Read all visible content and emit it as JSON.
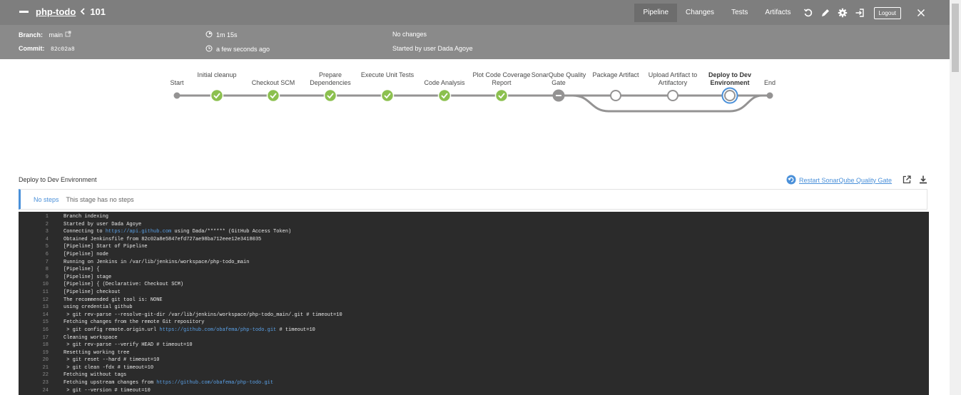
{
  "header": {
    "project": "php-todo",
    "build": "101",
    "tabs": [
      {
        "label": "Pipeline",
        "active": true
      },
      {
        "label": "Changes",
        "active": false
      },
      {
        "label": "Tests",
        "active": false
      },
      {
        "label": "Artifacts",
        "active": false
      }
    ],
    "logout": "Logout",
    "icons": [
      "replay-icon",
      "edit-icon",
      "gear-icon",
      "exit-icon",
      "close-icon"
    ],
    "branch_label": "Branch:",
    "branch_value": "main",
    "commit_label": "Commit:",
    "commit_value": "82c02a8",
    "duration": "1m 15s",
    "time_ago": "a few seconds ago",
    "changes": "No changes",
    "started_by": "Started by user Dada Agoye"
  },
  "pipeline": {
    "stages": [
      {
        "label": "Start",
        "status": "start"
      },
      {
        "label": "Initial cleanup",
        "status": "success"
      },
      {
        "label": "Checkout SCM",
        "status": "success"
      },
      {
        "label": "Prepare Dependencies",
        "status": "success"
      },
      {
        "label": "Execute Unit Tests",
        "status": "success"
      },
      {
        "label": "Code Analysis",
        "status": "success"
      },
      {
        "label": "Plot Code Coverage Report",
        "status": "success"
      },
      {
        "label": "SonarQube Quality Gate",
        "status": "aborted"
      },
      {
        "label": "Package Artifact",
        "status": "not-built"
      },
      {
        "label": "Upload Artifact to Artifactory",
        "status": "not-built"
      },
      {
        "label": "Deploy to Dev Environment",
        "status": "selected"
      },
      {
        "label": "End",
        "status": "end"
      }
    ]
  },
  "stage_panel": {
    "title": "Deploy to Dev Environment",
    "restart_label": "Restart SonarQube Quality Gate",
    "no_steps_label": "No steps",
    "no_steps_text": "This stage has no steps"
  },
  "console": {
    "lines": [
      {
        "n": "1",
        "text": "Branch indexing"
      },
      {
        "n": "2",
        "text": "Started by user Dada Agoye"
      },
      {
        "n": "3",
        "pre": "Connecting to ",
        "link": "https://api.github.com",
        "post": " using Dada/****** (GitHub Access Token)"
      },
      {
        "n": "4",
        "text": "Obtained Jenkinsfile from 82c02a8e5847efd727ae98ba712eee12e3418035"
      },
      {
        "n": "5",
        "text": "[Pipeline] Start of Pipeline"
      },
      {
        "n": "6",
        "text": "[Pipeline] node"
      },
      {
        "n": "7",
        "text": "Running on Jenkins in /var/lib/jenkins/workspace/php-todo_main"
      },
      {
        "n": "8",
        "text": "[Pipeline] {"
      },
      {
        "n": "9",
        "text": "[Pipeline] stage"
      },
      {
        "n": "10",
        "text": "[Pipeline] { (Declarative: Checkout SCM)"
      },
      {
        "n": "11",
        "text": "[Pipeline] checkout"
      },
      {
        "n": "12",
        "text": "The recommended git tool is: NONE"
      },
      {
        "n": "13",
        "text": "using credential github"
      },
      {
        "n": "14",
        "text": " > git rev-parse --resolve-git-dir /var/lib/jenkins/workspace/php-todo_main/.git # timeout=10"
      },
      {
        "n": "15",
        "text": "Fetching changes from the remote Git repository"
      },
      {
        "n": "16",
        "pre": " > git config remote.origin.url ",
        "link": "https://github.com/obafema/php-todo.git",
        "post": " # timeout=10"
      },
      {
        "n": "17",
        "text": "Cleaning workspace"
      },
      {
        "n": "18",
        "text": " > git rev-parse --verify HEAD # timeout=10"
      },
      {
        "n": "19",
        "text": "Resetting working tree"
      },
      {
        "n": "20",
        "text": " > git reset --hard # timeout=10"
      },
      {
        "n": "21",
        "text": " > git clean -fdx # timeout=10"
      },
      {
        "n": "22",
        "text": "Fetching without tags"
      },
      {
        "n": "23",
        "pre": "Fetching upstream changes from ",
        "link": "https://github.com/obafema/php-todo.git",
        "post": ""
      },
      {
        "n": "24",
        "text": " > git --version # timeout=10"
      }
    ]
  },
  "colors": {
    "success": "#8cc04f",
    "aborted": "#949393",
    "selected": "#4a90d9",
    "header": "#8a8a8a",
    "console_bg": "#2b2b2b",
    "link": "#5aa0e6"
  }
}
